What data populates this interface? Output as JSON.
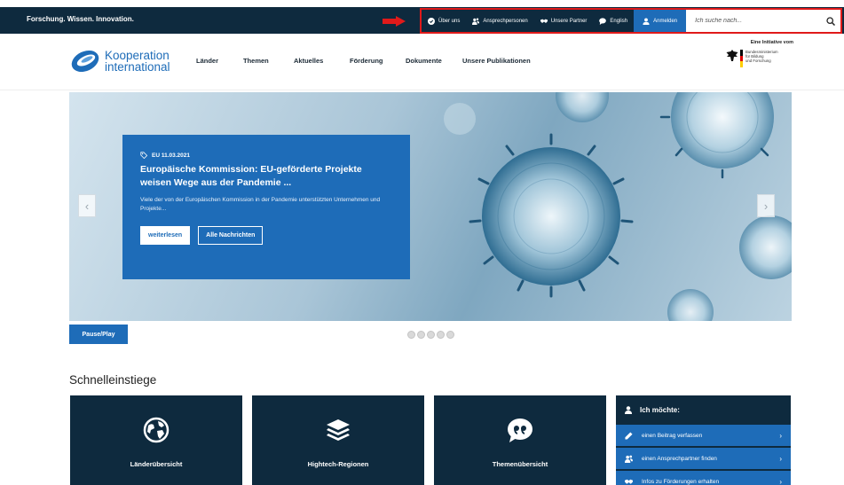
{
  "topbar": {
    "tagline": "Forschung. Wissen. Innovation.",
    "utility_items": [
      {
        "label": "Über uns",
        "icon": "circle-check-icon"
      },
      {
        "label": "Ansprechpersonen",
        "icon": "users-icon"
      },
      {
        "label": "Unsere Partner",
        "icon": "handshake-icon"
      },
      {
        "label": "English",
        "icon": "speech-bubble-icon"
      }
    ],
    "login_label": "Anmelden",
    "search_placeholder": "Ich suche nach..."
  },
  "header": {
    "logo_line1": "Kooperation",
    "logo_line2": "international",
    "nav": [
      "Länder",
      "Themen",
      "Aktuelles",
      "Förderung",
      "Dokumente",
      "Unsere Publikationen"
    ],
    "gov_title": "Eine Initiative vom",
    "gov_name_lines": [
      "Bundesministerium",
      "für Bildung",
      "und Forschung"
    ]
  },
  "hero": {
    "meta": "EU 11.03.2021",
    "title": "Europäische Kommission: EU-geförderte Projekte weisen Wege aus der Pandemie ...",
    "text": "Viele der von der Europäischen Kommission in der Pandemie unterstützten Unternehmen und Projekte...",
    "read_more": "weiterlesen",
    "all_news": "Alle Nachrichten",
    "prev_arrow": "‹",
    "next_arrow": "›"
  },
  "controls": {
    "pause_play": "Pause/Play",
    "dot_count": 5,
    "active_dot": 1
  },
  "quicklinks": {
    "title": "Schnelleinstiege",
    "tiles": [
      {
        "label": "Länderübersicht",
        "icon": "globe-icon"
      },
      {
        "label": "Hightech-Regionen",
        "icon": "layers-icon"
      },
      {
        "label": "Themenübersicht",
        "icon": "quote-icon"
      }
    ],
    "panel": {
      "title": "Ich möchte:",
      "items": [
        {
          "label": "einen Beitrag verfassen",
          "icon": "pencil-icon"
        },
        {
          "label": "einen Ansprechpartner finden",
          "icon": "users-icon"
        },
        {
          "label": "Infos zu Förderungen erhalten",
          "icon": "handshake-icon"
        }
      ]
    }
  },
  "colors": {
    "dark_navy": "#0e2a3e",
    "brand_blue": "#1e6cb8",
    "highlight_red": "#e01a1a"
  }
}
